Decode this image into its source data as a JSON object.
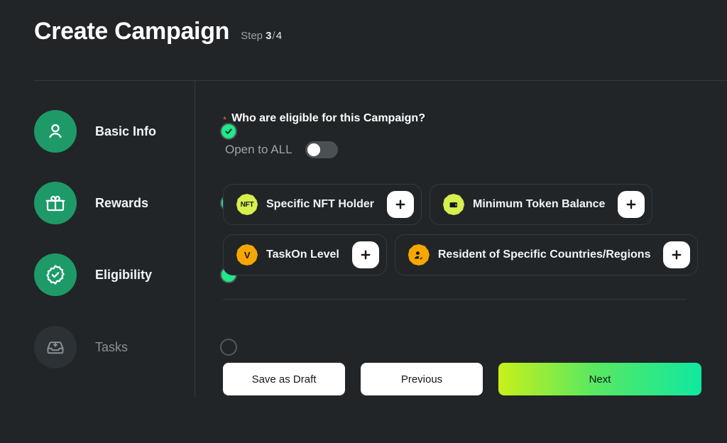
{
  "header": {
    "title": "Create Campaign",
    "step_prefix": "Step",
    "step_current": "3",
    "step_separator": "/",
    "step_total": "4"
  },
  "theme": {
    "background": "#212528",
    "accent_green": "#1ee98b",
    "step_icon_green": "#1d9a68",
    "required_orange": "#e8682c",
    "badge_lime": "#d7ef4f",
    "badge_amber": "#f5a700",
    "next_gradient_from": "#c8f019",
    "next_gradient_to": "#10e8a0"
  },
  "stepper": {
    "items": [
      {
        "label": "Basic Info",
        "icon": "user-icon",
        "state": "done",
        "marker": "check-badge-icon"
      },
      {
        "label": "Rewards",
        "icon": "gift-icon",
        "state": "done",
        "marker": "check-badge-icon"
      },
      {
        "label": "Eligibility",
        "icon": "verified-badge-icon",
        "state": "current",
        "marker": "current-dot"
      },
      {
        "label": "Tasks",
        "icon": "inbox-icon",
        "state": "todo",
        "marker": "empty-circle"
      }
    ]
  },
  "main": {
    "question": {
      "required_mark": "*",
      "text": "Who are eligible for this Campaign?"
    },
    "open_to_all": {
      "label": "Open to ALL",
      "value": "off"
    },
    "options": [
      {
        "label": "Specific NFT Holder",
        "badge_text": "NFT",
        "badge_icon": "nft-hexagon-icon",
        "badge_color": "#d7ef4f",
        "add_label": "+"
      },
      {
        "label": "Minimum Token Balance",
        "badge_text": "",
        "badge_icon": "wallet-hexagon-icon",
        "badge_color": "#d7ef4f",
        "add_label": "+"
      },
      {
        "label": "TaskOn Level",
        "badge_text": "V",
        "badge_icon": "level-hexagon-icon",
        "badge_color": "#f5a700",
        "add_label": "+"
      },
      {
        "label": "Resident of Specific Countries/Regions",
        "badge_text": "",
        "badge_icon": "person-check-hexagon-icon",
        "badge_color": "#f5a700",
        "add_label": "+"
      }
    ]
  },
  "footer": {
    "save_draft_label": "Save as Draft",
    "previous_label": "Previous",
    "next_label": "Next"
  }
}
